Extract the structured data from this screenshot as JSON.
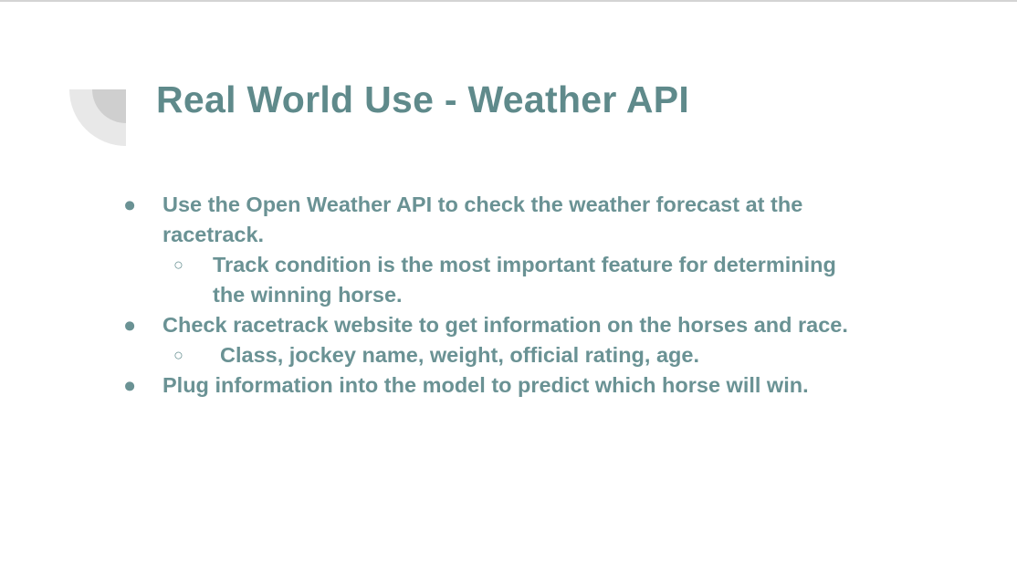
{
  "slide": {
    "title": "Real World Use - Weather API",
    "colors": {
      "title": "#5f8a8b",
      "body": "#6a9294",
      "decoration_light": "#e8e8e8",
      "decoration_dark": "#cfcfcf"
    },
    "bullet_glyph": "●",
    "sub_bullet_glyph": "○",
    "bullets": [
      {
        "text": "Use the Open Weather API to check the weather forecast at the racetrack.",
        "sub": [
          "Track condition is the most important feature for determining the winning horse."
        ]
      },
      {
        "text": "Check racetrack website to get information on the horses and race.",
        "sub": [
          "Class, jockey name, weight, official rating, age."
        ]
      },
      {
        "text": "Plug information into the model to predict which horse will win.",
        "sub": []
      }
    ]
  }
}
